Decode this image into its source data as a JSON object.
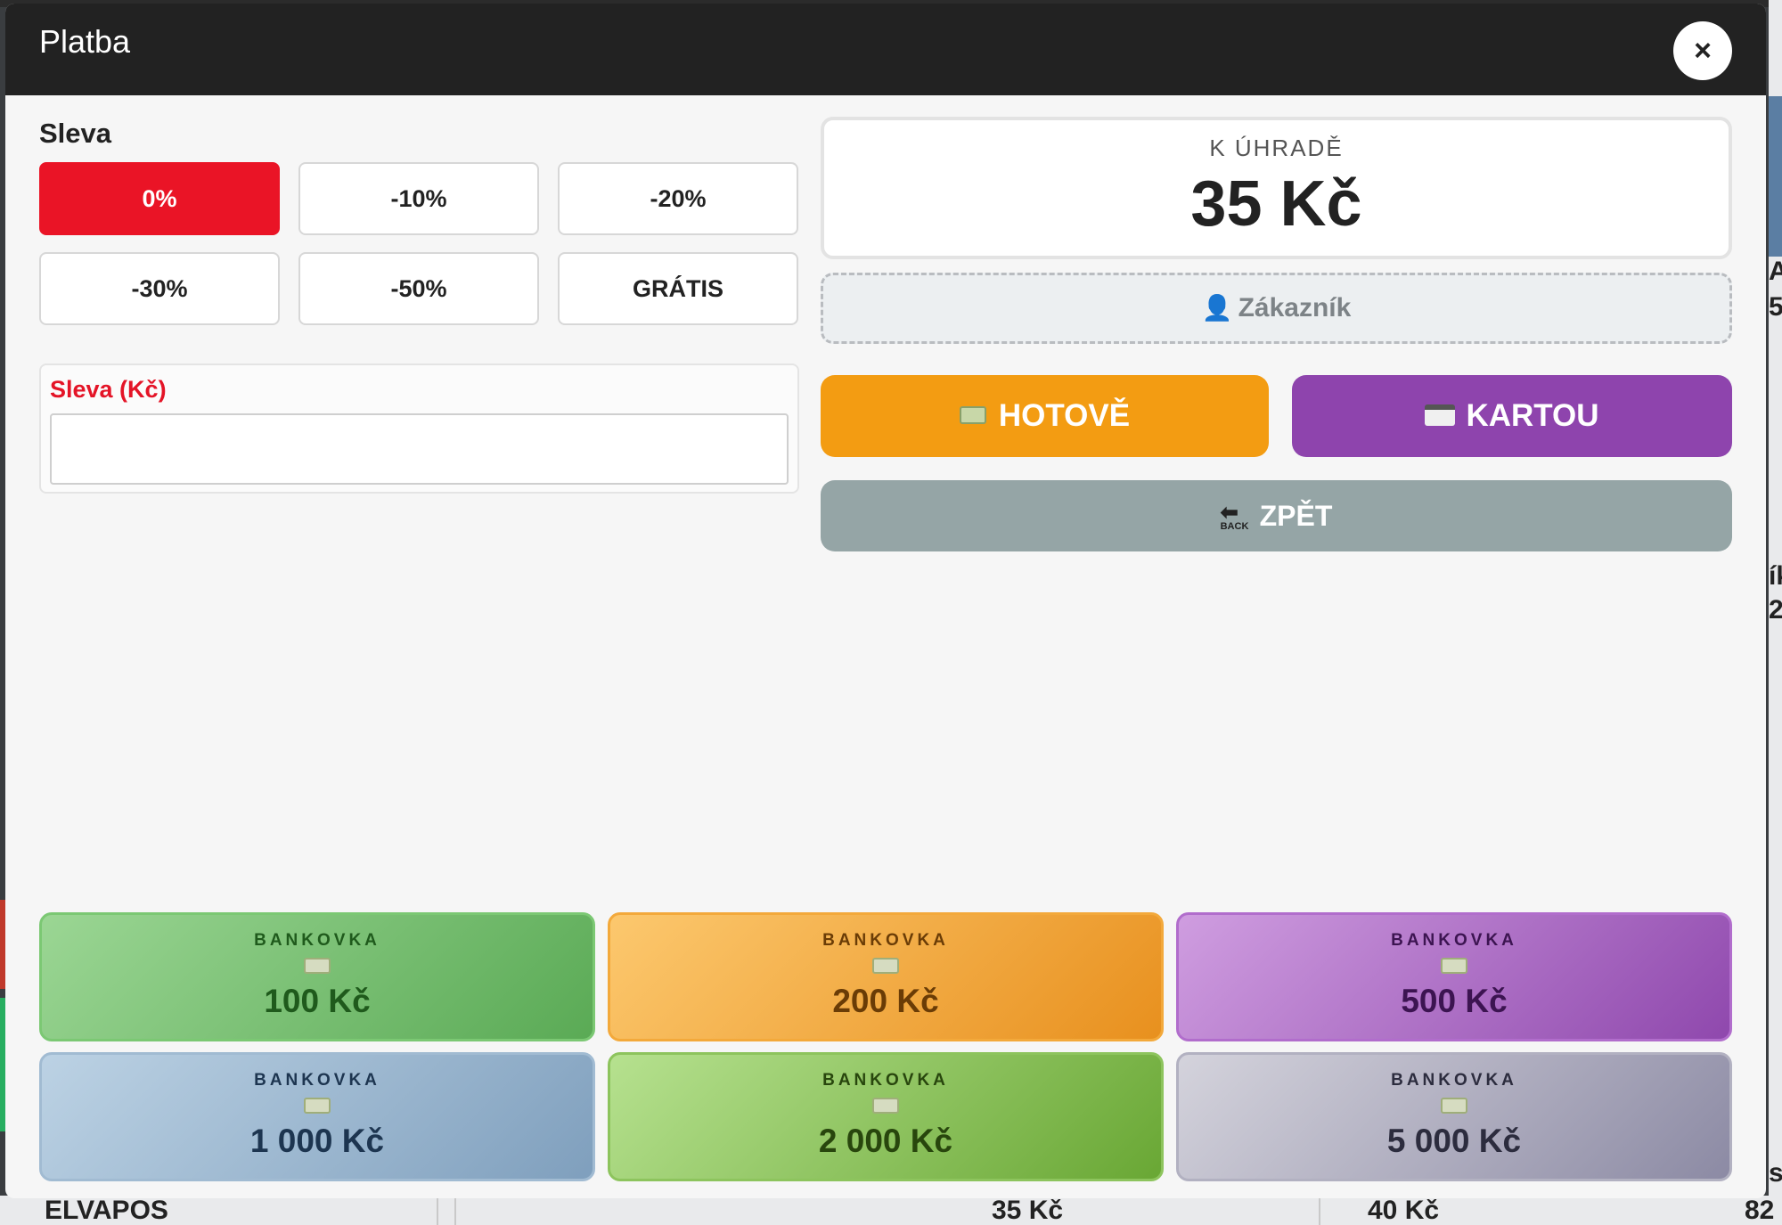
{
  "background": {
    "bottom_items": [
      "ELVAPOS",
      "35 Kč",
      "40 Kč",
      "82"
    ],
    "right_items": [
      "A",
      "5",
      "ík",
      "2",
      "s"
    ]
  },
  "modal": {
    "title": "Platba",
    "close_label": "×"
  },
  "discount": {
    "title": "Sleva",
    "options": [
      "0%",
      "-10%",
      "-20%",
      "-30%",
      "-50%",
      "GRÁTIS"
    ],
    "selected": "0%",
    "amount_label": "Sleva (Kč)",
    "amount_value": ""
  },
  "due": {
    "label": "K ÚHRADĚ",
    "value": "35 Kč"
  },
  "customer": {
    "label": "Zákazník",
    "icon": "person-icon"
  },
  "payment": {
    "cash_label": "HOTOVĚ",
    "card_label": "KARTOU",
    "back_label": "ZPĚT",
    "back_icon_text": "BACK",
    "cash_color": "#f39c12",
    "card_color": "#8e44ad",
    "back_color": "#95a5a6"
  },
  "banknotes": [
    {
      "label": "BANKOVKA",
      "value": "100 Kč"
    },
    {
      "label": "BANKOVKA",
      "value": "200 Kč"
    },
    {
      "label": "BANKOVKA",
      "value": "500 Kč"
    },
    {
      "label": "BANKOVKA",
      "value": "1 000 Kč"
    },
    {
      "label": "BANKOVKA",
      "value": "2 000 Kč"
    },
    {
      "label": "BANKOVKA",
      "value": "5 000 Kč"
    }
  ]
}
